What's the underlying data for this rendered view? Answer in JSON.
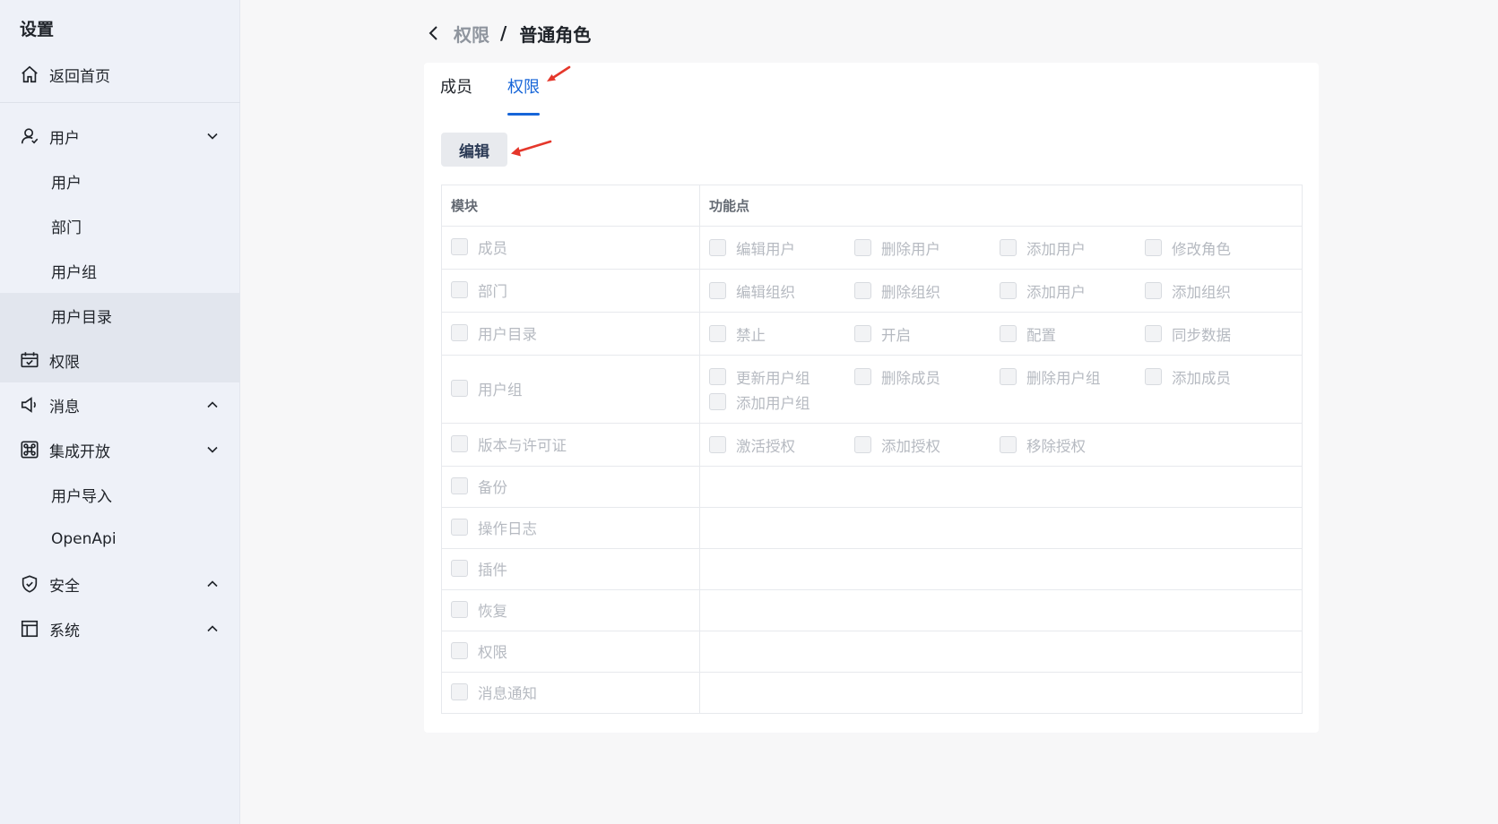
{
  "sidebar": {
    "title": "设置",
    "home": "返回首页",
    "users_group": "用户",
    "users_items": [
      "用户",
      "部门",
      "用户组",
      "用户目录"
    ],
    "permissions": "权限",
    "messages": "消息",
    "integration": "集成开放",
    "integration_items": [
      "用户导入",
      "OpenApi"
    ],
    "security": "安全",
    "system": "系统"
  },
  "breadcrumb": {
    "parent": "权限",
    "separator": "/",
    "current": "普通角色"
  },
  "tabs": [
    "成员",
    "权限"
  ],
  "edit_button": "编辑",
  "table": {
    "headers": [
      "模块",
      "功能点"
    ],
    "rows": [
      {
        "module": "成员",
        "features": [
          "编辑用户",
          "删除用户",
          "添加用户",
          "修改角色"
        ]
      },
      {
        "module": "部门",
        "features": [
          "编辑组织",
          "删除组织",
          "添加用户",
          "添加组织"
        ]
      },
      {
        "module": "用户目录",
        "features": [
          "禁止",
          "开启",
          "配置",
          "同步数据"
        ]
      },
      {
        "module": "用户组",
        "features": [
          "更新用户组",
          "删除成员",
          "删除用户组",
          "添加成员",
          "添加用户组"
        ]
      },
      {
        "module": "版本与许可证",
        "features": [
          "激活授权",
          "添加授权",
          "移除授权"
        ]
      },
      {
        "module": "备份",
        "features": []
      },
      {
        "module": "操作日志",
        "features": []
      },
      {
        "module": "插件",
        "features": []
      },
      {
        "module": "恢复",
        "features": []
      },
      {
        "module": "权限",
        "features": []
      },
      {
        "module": "消息通知",
        "features": []
      }
    ]
  },
  "colors": {
    "accent": "#1665d8",
    "annotation_arrow": "#e5372b"
  }
}
